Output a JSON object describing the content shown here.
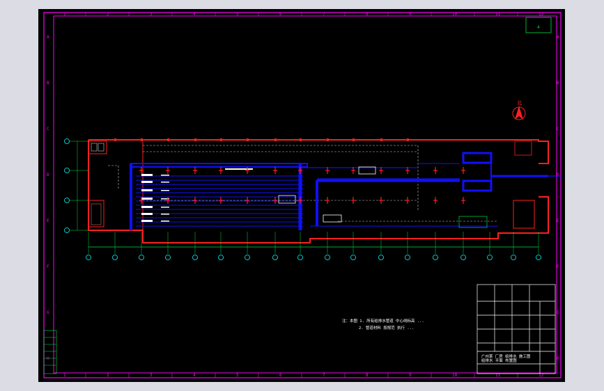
{
  "drawing": {
    "col_labels": [
      "1",
      "2",
      "3",
      "4",
      "5",
      "6",
      "7",
      "8",
      "9",
      "10",
      "11",
      "12"
    ],
    "row_labels": [
      "A",
      "B",
      "C",
      "D",
      "E",
      "F",
      "G",
      "H"
    ],
    "north_label": "北",
    "notes": [
      "注：本图 1. 所有给排水管道 中心线标高 ...",
      "2. 管道材料 按规范 执行 ..."
    ],
    "title_block": {
      "line1": "广州某 厂房 给排水 施工图",
      "line2": "给排水 平面 布置图"
    },
    "corner_tag": "4"
  },
  "colors": {
    "frame": "#ff00ff",
    "wall": "#ff2020",
    "pipe": "#1010ff",
    "green": "#00e040",
    "white": "#ffffff",
    "cyan": "#00ffff"
  }
}
